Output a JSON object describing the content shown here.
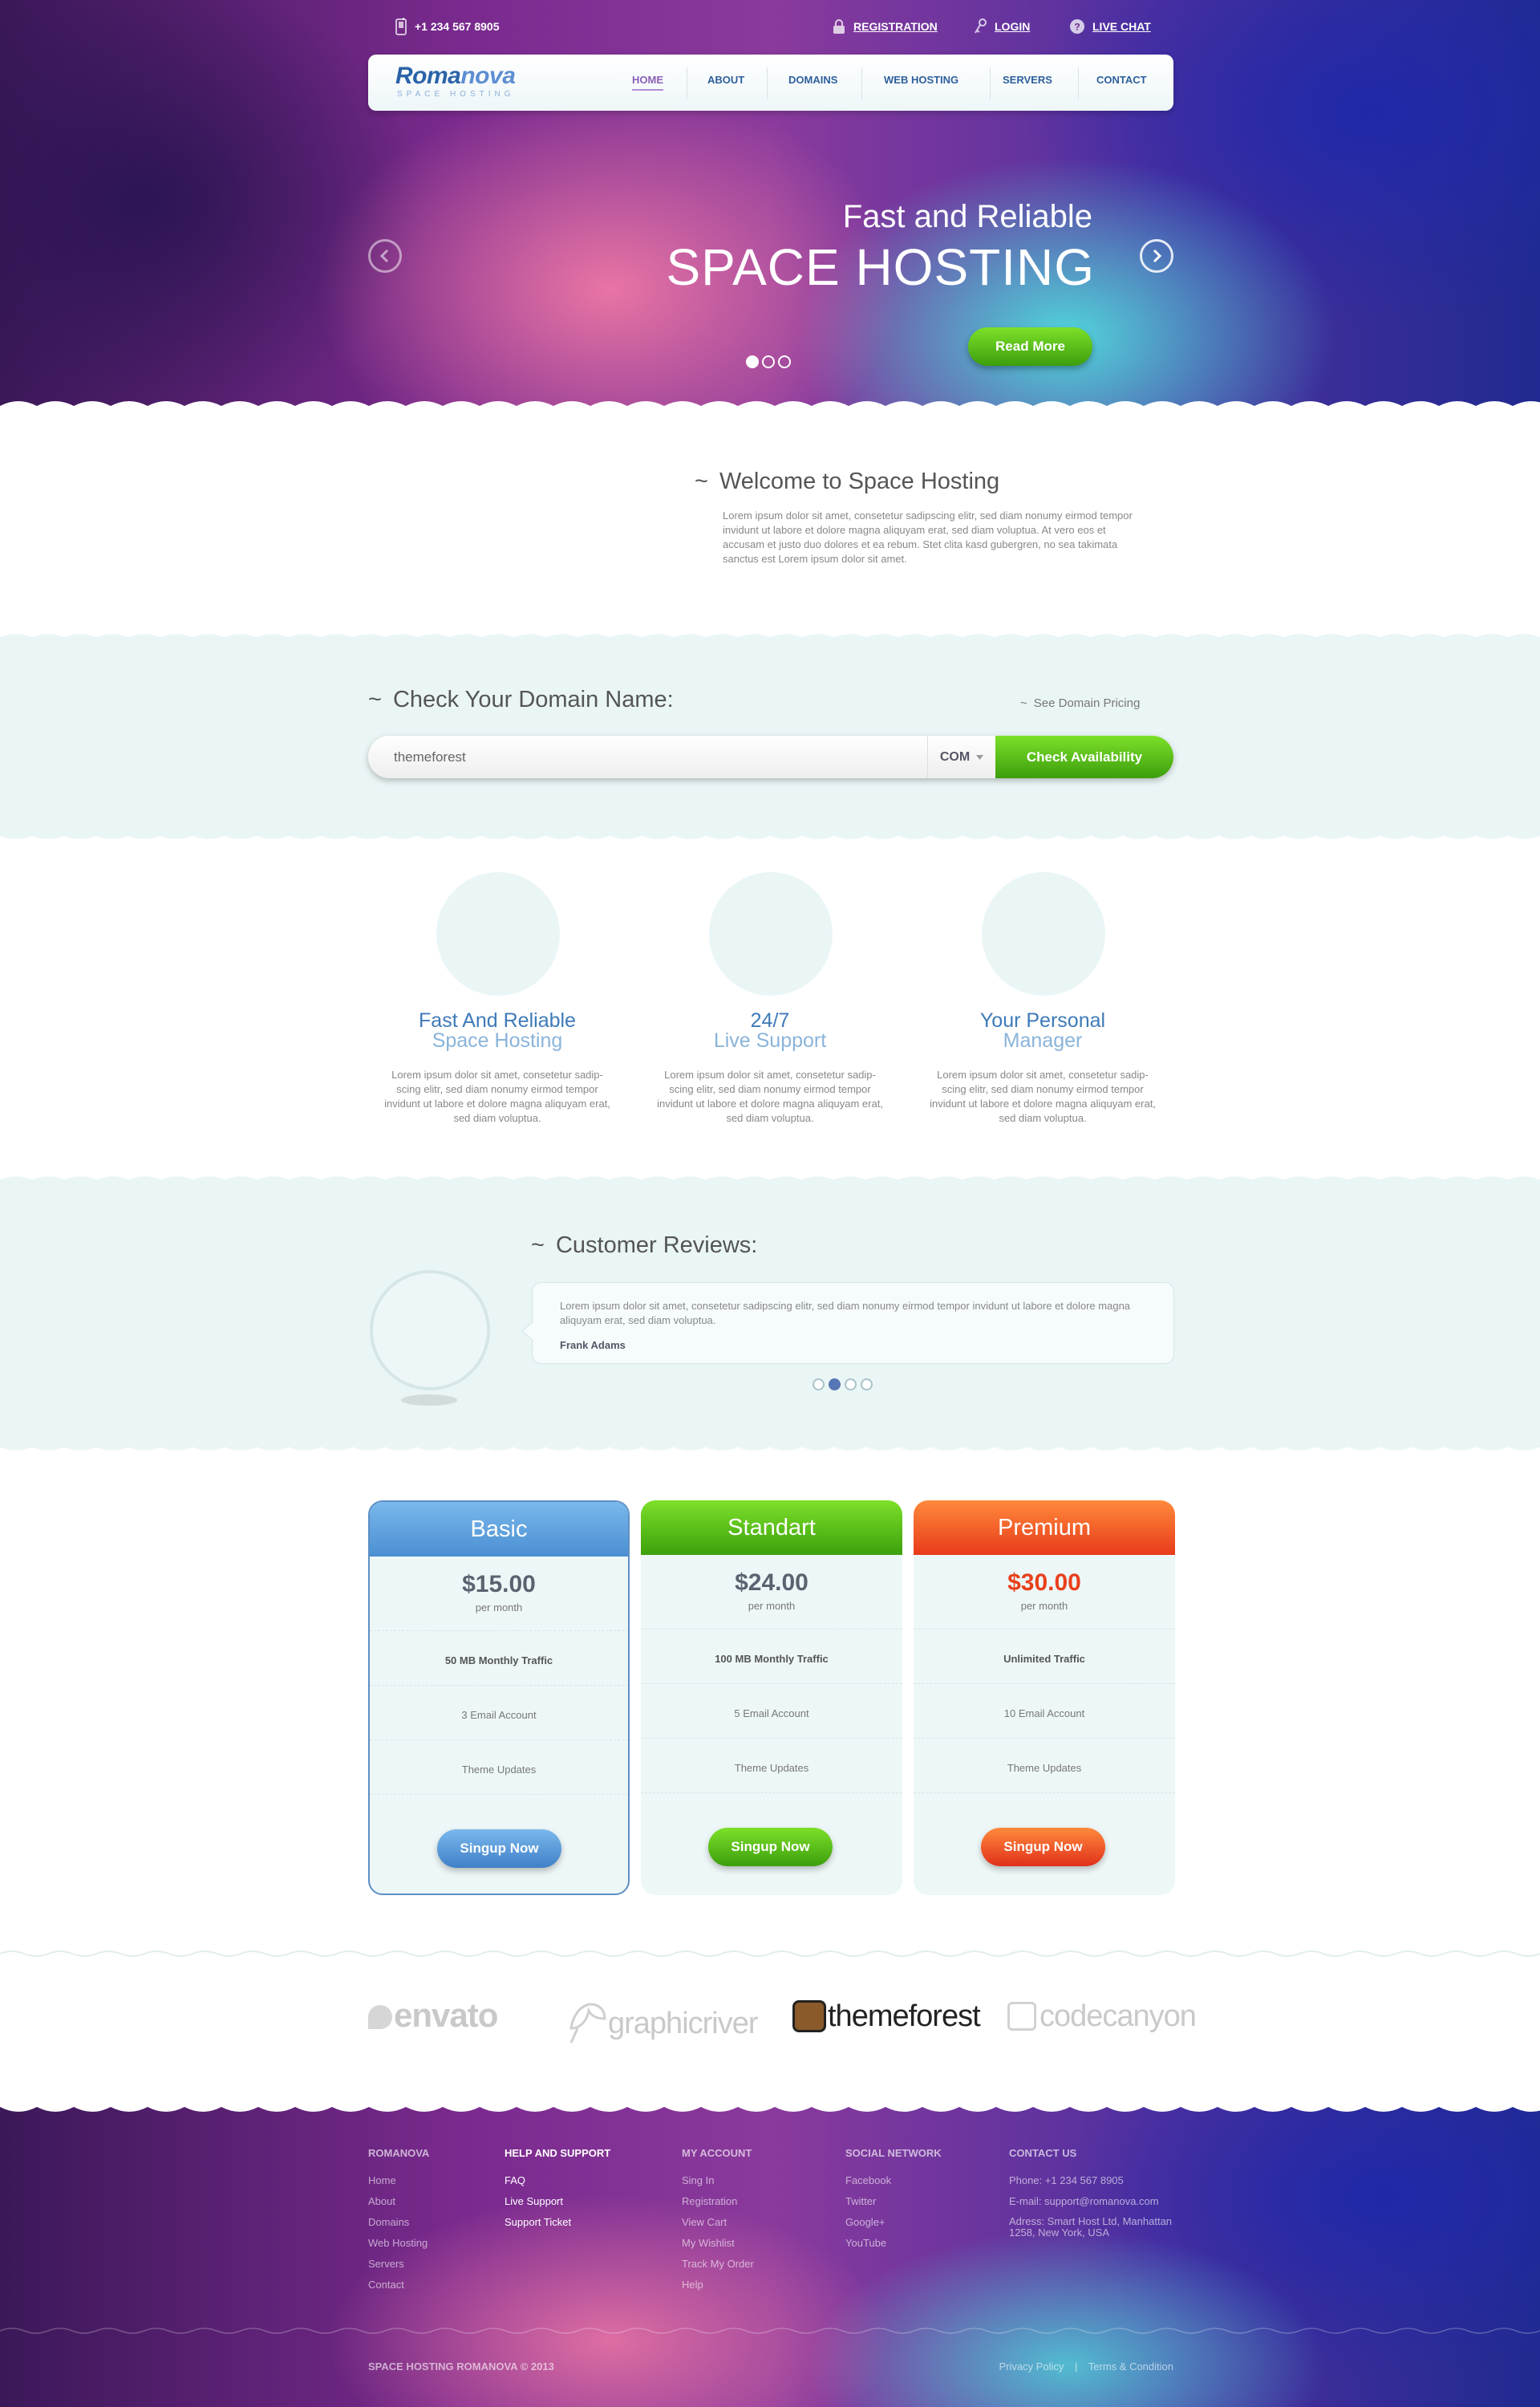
{
  "topbar": {
    "phone": "+1 234 567 8905",
    "registration": "REGISTRATION",
    "login": "LOGIN",
    "live_chat": "LIVE CHAT"
  },
  "logo": {
    "name_a": "Roma",
    "name_b": "nova",
    "tagline": "SPACE HOSTING"
  },
  "nav": {
    "items": [
      "HOME",
      "ABOUT",
      "DOMAINS",
      "WEB HOSTING",
      "SERVERS",
      "CONTACT"
    ],
    "active": "HOME"
  },
  "hero": {
    "subtitle": "Fast and Reliable",
    "title": "SPACE HOSTING",
    "cta": "Read More",
    "slides": 3,
    "active_slide": 1
  },
  "welcome": {
    "title": "Welcome to Space Hosting",
    "body": "Lorem ipsum dolor sit amet, consetetur sadipscing elitr, sed diam nonumy eirmod tempor invidunt ut labore et dolore magna aliquyam erat, sed diam voluptua.  At vero eos et accusam et justo duo dolores et ea rebum. Stet clita kasd gubergren, no sea takimata sanctus est Lorem ipsum dolor sit amet."
  },
  "domain": {
    "title": "Check Your Domain Name:",
    "pricing_link": "See Domain Pricing",
    "input_value": "themeforest",
    "tld": "COM",
    "button": "Check Availability"
  },
  "features": [
    {
      "line1": "Fast And Reliable",
      "line2": "Space Hosting",
      "body": "Lorem ipsum dolor sit amet, consetetur sadip- scing elitr, sed diam nonumy eirmod tempor invidunt ut labore et dolore magna aliquyam erat, sed diam voluptua."
    },
    {
      "line1": "24/7",
      "line2": "Live Support",
      "body": "Lorem ipsum dolor sit amet, consetetur sadip- scing elitr, sed diam nonumy eirmod tempor invidunt ut labore et dolore magna aliquyam erat, sed diam voluptua."
    },
    {
      "line1": "Your Personal",
      "line2": "Manager",
      "body": "Lorem ipsum dolor sit amet, consetetur sadip- scing elitr, sed diam nonumy eirmod tempor invidunt ut labore et dolore magna aliquyam erat, sed diam voluptua."
    }
  ],
  "reviews": {
    "title": "Customer Reviews:",
    "text": "Lorem ipsum dolor sit amet, consetetur sadipscing elitr, sed diam nonumy eirmod tempor invidunt ut labore et dolore magna aliquyam erat, sed diam voluptua.",
    "author": "Frank Adams",
    "slides": 4,
    "active_slide": 2
  },
  "plans": [
    {
      "name": "Basic",
      "price": "$15.00",
      "per": "per month",
      "traffic": "50 MB Monthly Traffic",
      "email": "3 Email Account",
      "updates": "Theme Updates",
      "button": "Singup Now",
      "color": "#5a9edf"
    },
    {
      "name": "Standart",
      "price": "$24.00",
      "per": "per month",
      "traffic": "100 MB Monthly Traffic",
      "email": "5 Email Account",
      "updates": "Theme Updates",
      "button": "Singup Now",
      "color": "#4cbb14"
    },
    {
      "name": "Premium",
      "price": "$30.00",
      "per": "per month",
      "traffic": "Unlimited Traffic",
      "email": "10 Email Account",
      "updates": "Theme Updates",
      "button": "Singup Now",
      "color": "#ee4a1e"
    }
  ],
  "partners": [
    "envato",
    "graphicriver",
    "themeforest",
    "codecanyon"
  ],
  "footer": {
    "col1": {
      "title": "ROMANOVA",
      "links": [
        "Home",
        "About",
        "Domains",
        "Web Hosting",
        "Servers",
        "Contact"
      ]
    },
    "col2": {
      "title": "HELP AND SUPPORT",
      "links": [
        "FAQ",
        "Live Support",
        "Support Ticket"
      ]
    },
    "col3": {
      "title": "MY ACCOUNT",
      "links": [
        "Sing In",
        "Registration",
        "View Cart",
        "My Wishlist",
        "Track My Order",
        "Help"
      ]
    },
    "col4": {
      "title": "SOCIAL NETWORK",
      "links": [
        "Facebook",
        "Twitter",
        "Google+",
        "YouTube"
      ]
    },
    "col5": {
      "title": "CONTACT US",
      "phone": "Phone: +1 234 567 8905",
      "email": "E-mail: support@romanova.com",
      "address": "Adress: Smart Host Ltd, Manhattan 1258, New York, USA"
    },
    "copyright": "SPACE HOSTING ROMANOVA © 2013",
    "privacy": "Privacy Policy",
    "separator": "|",
    "terms": "Terms & Condition"
  }
}
